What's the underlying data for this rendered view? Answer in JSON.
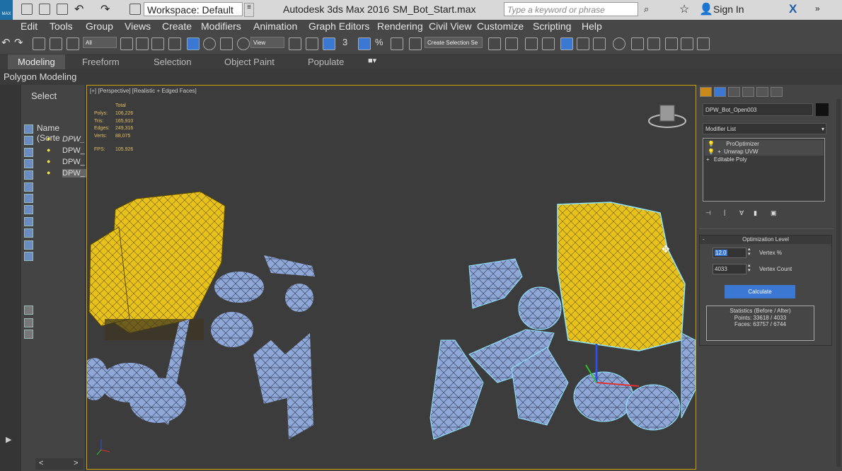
{
  "titlebar": {
    "workspace": "Workspace: Default",
    "app_title": "Autodesk 3ds Max 2016",
    "file_name": "SM_Bot_Start.max",
    "search_placeholder": "Type a keyword or phrase",
    "sign_in": "Sign In",
    "logo_text": "MAX"
  },
  "menu": [
    "Edit",
    "Tools",
    "Group",
    "Views",
    "Create",
    "Modifiers",
    "Animation",
    "Graph Editors",
    "Rendering",
    "Civil View",
    "Customize",
    "Scripting",
    "Help"
  ],
  "toolbar": {
    "filter_value": "All",
    "view_value": "View",
    "snap_label": "3",
    "angle_snap": "%",
    "create_selection_set": "Create Selection Se"
  },
  "ribbon": {
    "tabs": [
      "Modeling",
      "Freeform",
      "Selection",
      "Object Paint",
      "Populate"
    ],
    "active": "Modeling",
    "subpanel": "Polygon Modeling"
  },
  "scene_explorer": {
    "select_label": "Select",
    "column_header": "Name (Sorte",
    "items": [
      "DPW_",
      "DPW_",
      "DPW_",
      "DPW_"
    ],
    "nav_left": "<",
    "nav_right": ">"
  },
  "viewport": {
    "label": "[+] [Perspective] [Realistic + Edged Faces]",
    "stats": {
      "total_label": "Total",
      "polys_label": "Polys:",
      "polys": "106,226",
      "tris_label": "Tris:",
      "tris": "165,910",
      "edges_label": "Edges:",
      "edges": "249,316",
      "verts_label": "Verts:",
      "verts": "88,075",
      "fps_label": "FPS:",
      "fps": "105.926"
    },
    "wire_color": "#8fa8d8",
    "body_color": "#e8c21a",
    "highlight_color": "#8fe8ff"
  },
  "command_panel": {
    "object_name": "DPW_Bot_Open003",
    "modifier_list": "Modifier List",
    "stack": [
      "ProOptimizer",
      "Unwrap UVW",
      "Editable Poly"
    ],
    "optimization_header": "Optimization Level",
    "vertex_percent_value": "12.0",
    "vertex_percent_label": "Vertex %",
    "vertex_count_value": "4033",
    "vertex_count_label": "Vertex Count",
    "calculate": "Calculate",
    "statistics_title": "Statistics (Before / After)",
    "statistics_points": "Points: 33618 / 4033",
    "statistics_faces": "Faces: 63757 / 6744",
    "collapse_symbol": "-"
  }
}
